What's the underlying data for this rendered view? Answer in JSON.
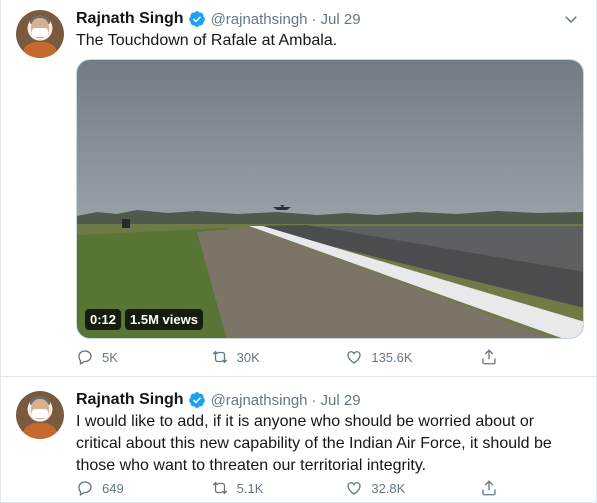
{
  "tweets": [
    {
      "author_name": "Rajnath Singh",
      "handle": "@rajnathsingh",
      "separator": "·",
      "date": "Jul 29",
      "text": "The Touchdown of Rafale at Ambala.",
      "media": {
        "type": "video",
        "duration": "0:12",
        "views": "1.5M views"
      },
      "replies": "5K",
      "retweets": "30K",
      "likes": "135.6K",
      "icons": {
        "reply": "reply-icon",
        "retweet": "retweet-icon",
        "like": "heart-icon",
        "share": "share-icon",
        "verified": "verified-badge-icon",
        "more": "chevron-down-icon"
      }
    },
    {
      "author_name": "Rajnath Singh",
      "handle": "@rajnathsingh",
      "separator": "·",
      "date": "Jul 29",
      "text_lines": [
        "I would like to add, if it is anyone who should be worried about or",
        "critical about this new capability of the Indian Air Force, it should be",
        "those who want to threaten our territorial integrity."
      ],
      "replies": "649",
      "retweets": "5.1K",
      "likes": "32.8K"
    }
  ],
  "colors": {
    "verified": "#1da1f2",
    "secondary_text": "#657786",
    "border": "#e1e8ed"
  }
}
